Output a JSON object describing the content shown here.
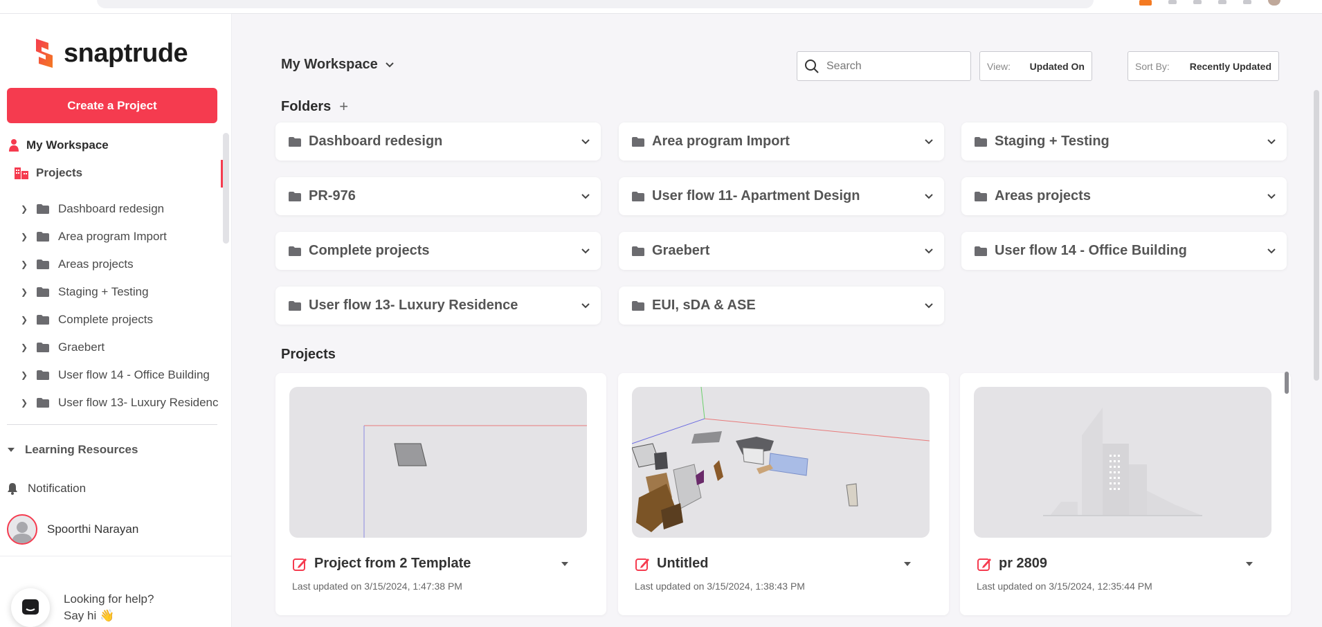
{
  "brand": {
    "name": "snaptrude",
    "accent": "#f53b4f"
  },
  "sidebar": {
    "create_label": "Create a Project",
    "workspace_label": "My Workspace",
    "projects_label": "Projects",
    "tree": [
      {
        "label": "Dashboard redesign"
      },
      {
        "label": "Area program Import"
      },
      {
        "label": "Areas projects"
      },
      {
        "label": "Staging + Testing"
      },
      {
        "label": "Complete projects"
      },
      {
        "label": "Graebert"
      },
      {
        "label": "User flow 14 - Office Building"
      },
      {
        "label": "User flow 13- Luxury Residenc"
      }
    ],
    "learning_label": "Learning Resources",
    "notification_label": "Notification",
    "user_name": "Spoorthi Narayan",
    "help_line1": "Looking for help?",
    "help_line2": "Say hi 👋"
  },
  "header": {
    "workspace_dropdown": "My Workspace",
    "search_placeholder": "Search",
    "view_label": "View:",
    "view_value": "Updated On",
    "sort_label": "Sort By:",
    "sort_value": "Recently Updated"
  },
  "folders": {
    "title": "Folders",
    "add_symbol": "+",
    "items": [
      {
        "name": "Dashboard redesign"
      },
      {
        "name": "Area program Import"
      },
      {
        "name": "Staging + Testing"
      },
      {
        "name": "PR-976"
      },
      {
        "name": "User flow 11- Apartment Design"
      },
      {
        "name": "Areas projects"
      },
      {
        "name": "Complete projects"
      },
      {
        "name": "Graebert"
      },
      {
        "name": "User flow 14 - Office Building"
      },
      {
        "name": "User flow 13- Luxury Residence"
      },
      {
        "name": "EUI, sDA & ASE"
      }
    ]
  },
  "projects": {
    "title": "Projects",
    "items": [
      {
        "name": "Project from 2 Template",
        "updated": "Last updated on 3/15/2024, 1:47:38 PM"
      },
      {
        "name": "Untitled",
        "updated": "Last updated on 3/15/2024, 1:38:43 PM"
      },
      {
        "name": "pr 2809",
        "updated": "Last updated on 3/15/2024, 12:35:44 PM"
      }
    ]
  }
}
